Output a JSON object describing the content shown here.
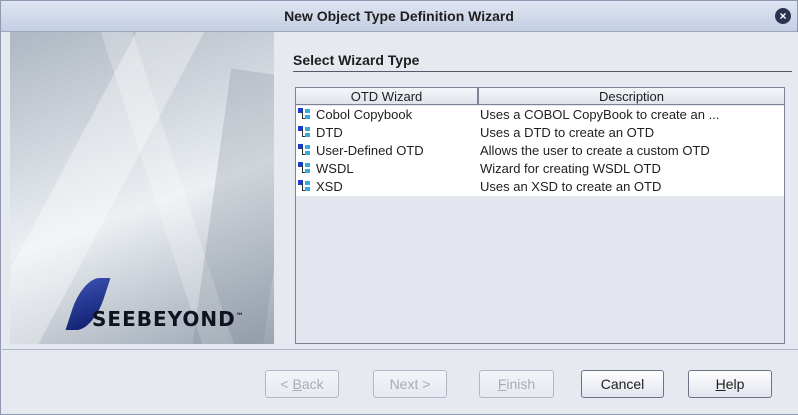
{
  "window": {
    "title": "New Object Type Definition Wizard"
  },
  "branding": {
    "logo_text": "SEEBEYOND",
    "tm": "™"
  },
  "section": {
    "title": "Select Wizard Type"
  },
  "table": {
    "columns": [
      "OTD Wizard",
      "Description"
    ],
    "rows": [
      {
        "name": "Cobol Copybook",
        "description": "Uses a COBOL CopyBook to create an ...",
        "icon": "otd-tree-icon"
      },
      {
        "name": "DTD",
        "description": "Uses a DTD to create an OTD",
        "icon": "otd-tree-icon"
      },
      {
        "name": "User-Defined OTD",
        "description": "Allows the user to create a custom OTD",
        "icon": "otd-tree-icon"
      },
      {
        "name": "WSDL",
        "description": "Wizard for creating WSDL OTD",
        "icon": "otd-tree-icon"
      },
      {
        "name": "XSD",
        "description": "Uses an XSD to create an OTD",
        "icon": "otd-tree-icon"
      }
    ]
  },
  "buttons": {
    "back": {
      "mnemonic": "B",
      "rest": "ack",
      "prefix": "< "
    },
    "next": {
      "label": "Next >"
    },
    "finish": {
      "mnemonic": "F",
      "rest": "inish"
    },
    "cancel": {
      "label": "Cancel"
    },
    "help": {
      "mnemonic": "H",
      "rest": "elp"
    }
  },
  "colors": {
    "accent": "#1a3cc8",
    "icon_secondary": "#39a9d9",
    "title_bg": "#c4cee3"
  }
}
